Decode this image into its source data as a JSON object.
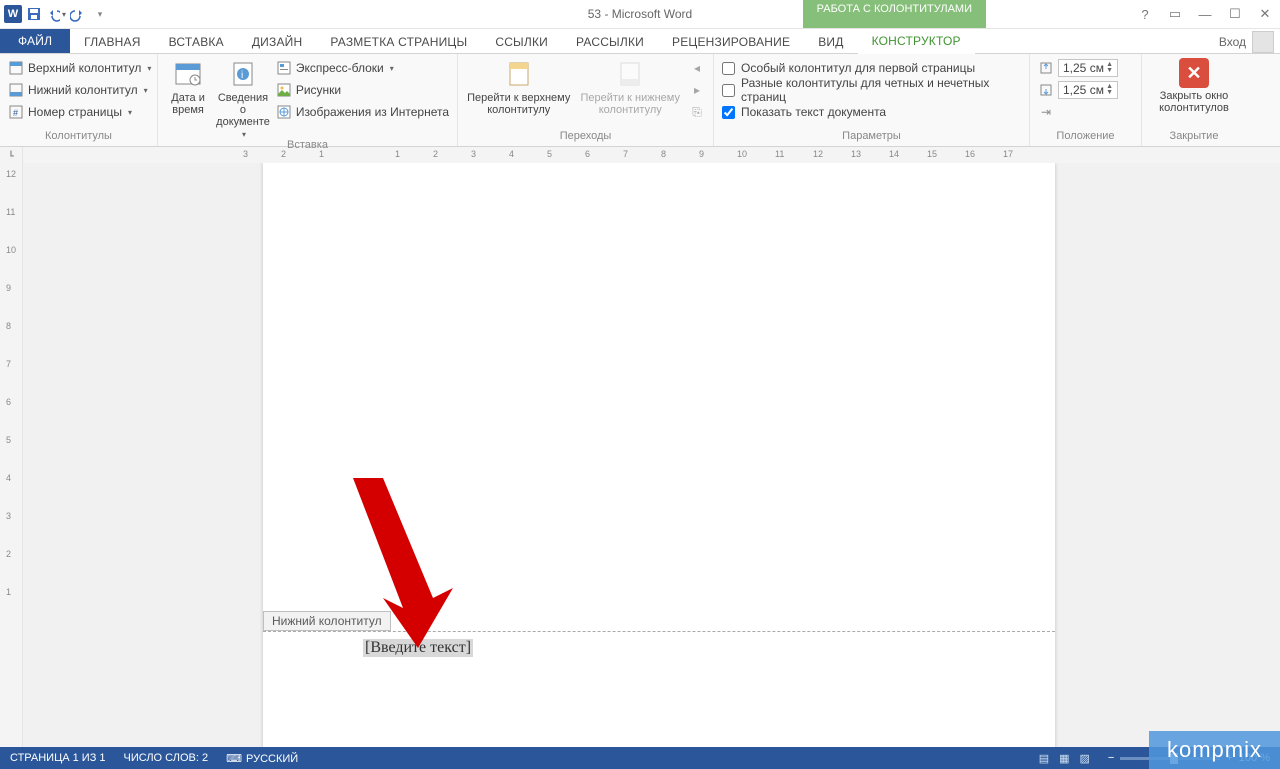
{
  "title": "53 - Microsoft Word",
  "context_tab": "РАБОТА С КОЛОНТИТУЛАМИ",
  "signin": "Вход",
  "tabs": {
    "file": "ФАЙЛ",
    "home": "ГЛАВНАЯ",
    "insert": "ВСТАВКА",
    "design": "ДИЗАЙН",
    "layout": "РАЗМЕТКА СТРАНИЦЫ",
    "references": "ССЫЛКИ",
    "mailings": "РАССЫЛКИ",
    "review": "РЕЦЕНЗИРОВАНИЕ",
    "view": "ВИД",
    "designer": "КОНСТРУКТОР"
  },
  "ribbon": {
    "hf": {
      "header": "Верхний колонтитул",
      "footer": "Нижний колонтитул",
      "page_number": "Номер страницы",
      "label": "Колонтитулы"
    },
    "insert": {
      "date": "Дата и время",
      "docinfo": "Сведения о документе",
      "quickparts": "Экспресс-блоки",
      "pictures": "Рисунки",
      "online_pics": "Изображения из Интернета",
      "label": "Вставка"
    },
    "nav": {
      "goto_header": "Перейти к верхнему колонтитулу",
      "goto_footer": "Перейти к нижнему колонтитулу",
      "label": "Переходы"
    },
    "options": {
      "first_page": "Особый колонтитул для первой страницы",
      "odd_even": "Разные колонтитулы для четных и нечетных страниц",
      "show_doc": "Показать текст документа",
      "label": "Параметры"
    },
    "position": {
      "top_value": "1,25 см",
      "bottom_value": "1,25 см",
      "label": "Положение"
    },
    "close": {
      "button": "Закрыть окно колонтитулов",
      "label": "Закрытие"
    }
  },
  "ruler_h": [
    "3",
    "2",
    "1",
    "",
    "1",
    "2",
    "3",
    "4",
    "5",
    "6",
    "7",
    "8",
    "9",
    "10",
    "11",
    "12",
    "13",
    "14",
    "15",
    "16",
    "17"
  ],
  "ruler_v": [
    "12",
    "11",
    "10",
    "9",
    "8",
    "7",
    "6",
    "5",
    "4",
    "3",
    "2",
    "1"
  ],
  "page": {
    "footer_tag": "Нижний колонтитул",
    "placeholder": "[Введите текст]"
  },
  "status": {
    "page": "СТРАНИЦА 1 ИЗ 1",
    "words": "ЧИСЛО СЛОВ: 2",
    "lang": "РУССКИЙ",
    "zoom": "100 %"
  },
  "watermark": "kompmix"
}
